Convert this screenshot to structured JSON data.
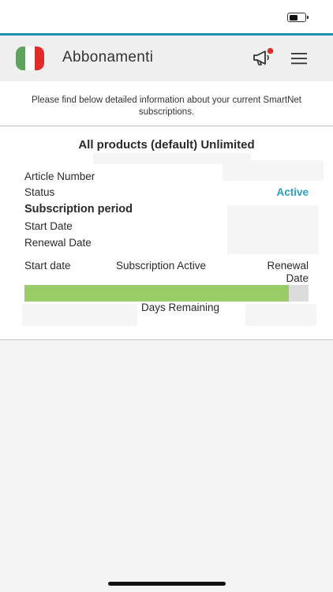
{
  "header": {
    "title": "Abbonamenti",
    "flag_icon": "italy-flag-icon",
    "notification_icon": "megaphone-icon",
    "menu_icon": "hamburger-menu-icon"
  },
  "info_banner": {
    "text": "Please find below detailed information about your current SmartNet subscriptions."
  },
  "subscription": {
    "title": "All products (default) Unlimited",
    "article_number_label": "Article Number",
    "status_label": "Status",
    "status_value": "Active",
    "period_heading": "Subscription period",
    "start_date_label": "Start Date",
    "renewal_date_label": "Renewal Date",
    "timeline": {
      "start_label": "Start date",
      "middle_label": "Subscription Active",
      "end_label": "Renewal Date",
      "progress_fraction": 0.93,
      "days_remaining_label": "Days Remaining"
    }
  },
  "colors": {
    "accent": "#1f93ad",
    "status_active": "#2a9fbd",
    "progress_fill": "#99cc66",
    "progress_track": "#dcdcdc"
  }
}
